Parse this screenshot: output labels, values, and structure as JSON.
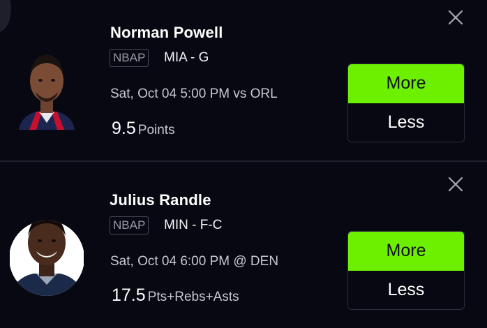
{
  "players": [
    {
      "name": "Norman Powell",
      "league": "NBAP",
      "team_position": "MIA - G",
      "game": "Sat, Oct 04 5:00 PM vs ORL",
      "line_value": "9.5",
      "stat": "Points",
      "more_label": "More",
      "less_label": "Less"
    },
    {
      "name": "Julius Randle",
      "league": "NBAP",
      "team_position": "MIN - F-C",
      "game": "Sat, Oct 04 6:00 PM @ DEN",
      "line_value": "17.5",
      "stat": "Pts+Rebs+Asts",
      "more_label": "More",
      "less_label": "Less"
    }
  ],
  "colors": {
    "background": "#080812",
    "more_button": "#6cf000",
    "divider": "#22222e"
  },
  "icons": {
    "close": "close-icon"
  }
}
